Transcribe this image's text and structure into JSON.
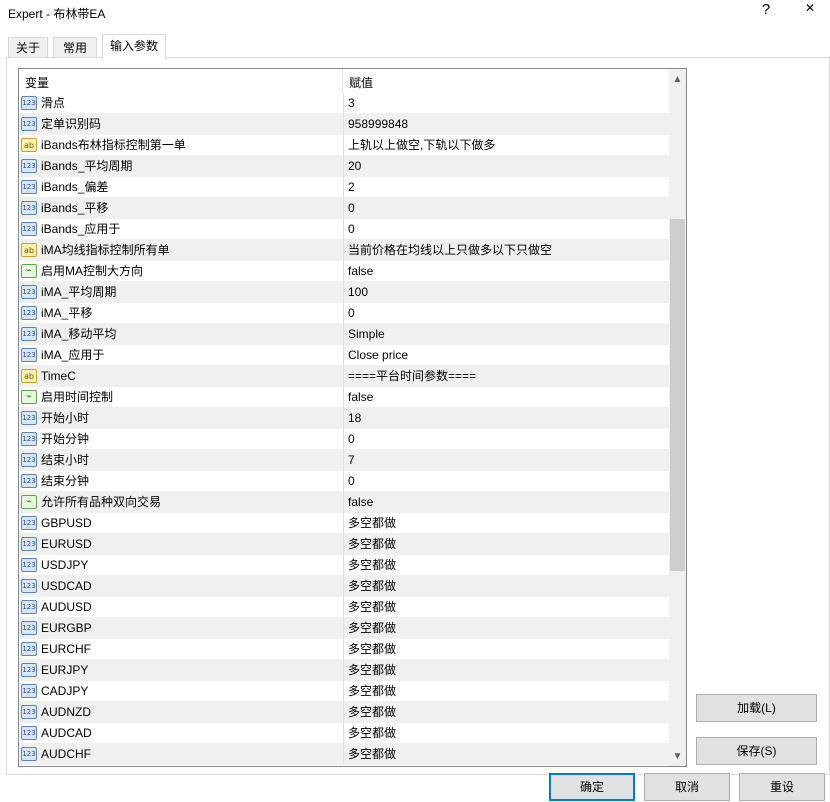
{
  "window": {
    "title": "Expert - 布林带EA",
    "help_glyph": "?",
    "close_glyph": "✕"
  },
  "tabs": [
    {
      "label": "关于"
    },
    {
      "label": "常用"
    },
    {
      "label": "输入参数"
    }
  ],
  "grid": {
    "col_name": "变量",
    "col_value": "赋值",
    "rows": [
      {
        "type": "num",
        "name": "滑点",
        "value": "3"
      },
      {
        "type": "num",
        "name": "定单识别码",
        "value": "958999848"
      },
      {
        "type": "str",
        "name": "iBands布林指标控制第一单",
        "value": "上轨以上做空,下轨以下做多"
      },
      {
        "type": "num",
        "name": "iBands_平均周期",
        "value": "20"
      },
      {
        "type": "num",
        "name": "iBands_偏差",
        "value": "2"
      },
      {
        "type": "num",
        "name": "iBands_平移",
        "value": "0"
      },
      {
        "type": "num",
        "name": "iBands_应用于",
        "value": "0"
      },
      {
        "type": "str",
        "name": "iMA均线指标控制所有单",
        "value": "当前价格在均线以上只做多以下只做空"
      },
      {
        "type": "bool",
        "name": "启用MA控制大方向",
        "value": "false"
      },
      {
        "type": "num",
        "name": "iMA_平均周期",
        "value": "100"
      },
      {
        "type": "num",
        "name": "iMA_平移",
        "value": "0"
      },
      {
        "type": "num",
        "name": "iMA_移动平均",
        "value": "Simple"
      },
      {
        "type": "num",
        "name": "iMA_应用于",
        "value": "Close price"
      },
      {
        "type": "str",
        "name": "TimeC",
        "value": "====平台时间参数===="
      },
      {
        "type": "bool",
        "name": "启用时间控制",
        "value": "false"
      },
      {
        "type": "num",
        "name": "开始小时",
        "value": "18"
      },
      {
        "type": "num",
        "name": "开始分钟",
        "value": "0"
      },
      {
        "type": "num",
        "name": "结束小时",
        "value": "7"
      },
      {
        "type": "num",
        "name": "结束分钟",
        "value": "0"
      },
      {
        "type": "bool",
        "name": "允许所有品种双向交易",
        "value": "false"
      },
      {
        "type": "num",
        "name": "GBPUSD",
        "value": "多空都做"
      },
      {
        "type": "num",
        "name": "EURUSD",
        "value": "多空都做"
      },
      {
        "type": "num",
        "name": "USDJPY",
        "value": "多空都做"
      },
      {
        "type": "num",
        "name": "USDCAD",
        "value": "多空都做"
      },
      {
        "type": "num",
        "name": "AUDUSD",
        "value": "多空都做"
      },
      {
        "type": "num",
        "name": "EURGBP",
        "value": "多空都做"
      },
      {
        "type": "num",
        "name": "EURCHF",
        "value": "多空都做"
      },
      {
        "type": "num",
        "name": "EURJPY",
        "value": "多空都做"
      },
      {
        "type": "num",
        "name": "CADJPY",
        "value": "多空都做"
      },
      {
        "type": "num",
        "name": "AUDNZD",
        "value": "多空都做"
      },
      {
        "type": "num",
        "name": "AUDCAD",
        "value": "多空都做"
      },
      {
        "type": "num",
        "name": "AUDCHF",
        "value": "多空都做"
      }
    ],
    "icon_glyphs": {
      "num": "123",
      "str": "ab",
      "bool": "⌁"
    }
  },
  "scrollbar": {
    "up": "▲",
    "down": "▼"
  },
  "buttons": {
    "load": "加载(L)",
    "save": "保存(S)",
    "ok": "确定",
    "cancel": "取消",
    "reset": "重设"
  },
  "colors": {
    "accent": "#0078d7",
    "header_border": "#828790"
  }
}
